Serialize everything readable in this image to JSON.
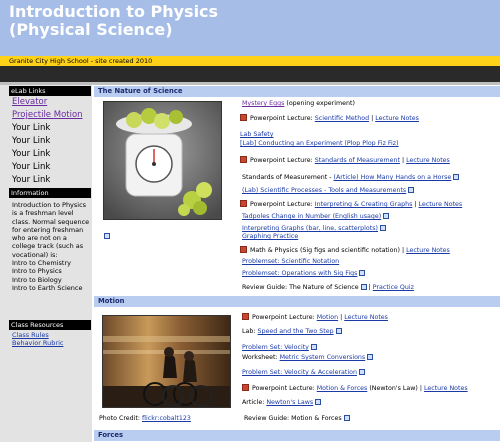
{
  "header": {
    "title_line1": "Introduction to Physics",
    "title_line2": "(Physical Science)",
    "subtitle": "Granite City High School - site created 2010"
  },
  "colors": {
    "header_bg": "#a6bde8",
    "yellow_bar": "#ffd21a",
    "section_head_bg": "#b8cdf0",
    "link": "#1a3aa8",
    "visited_link": "#6a2ca0"
  },
  "sidebar": {
    "elab_head": "eLab Links",
    "elab_links": [
      "Elevator",
      "Projectile Motion"
    ],
    "your_links": [
      "Your Link",
      "Your Link",
      "Your Link",
      "Your Link",
      "Your Link"
    ],
    "info_head": "Information",
    "info_text": "Introduction to Physics is a freshman level class. Normal sequence for entering freshman who are not on a college track (such as vocational) is:",
    "info_sequence": [
      "Intro to Chemistry",
      "Intro to Physics",
      "Intro to Biology",
      "Intro to Earth Science"
    ],
    "resources_head": "Class Resources",
    "resources": [
      "Class Rules",
      "Behavior Rubric"
    ]
  },
  "sections": {
    "science": {
      "title": "The Nature of Science",
      "mystery_eggs": "Mystery Eggs",
      "mystery_eggs_note": " (opening experiment)",
      "ppt1_prefix": "Powerpoint Lecture: ",
      "ppt1_link": "Scientific Method",
      "sep": " | ",
      "lecture_notes": "Lecture Notes",
      "lab_safety": "Lab Safety",
      "lab_experiment": "[Lab] Conducting an Experiment (Plop Plop Fiz Fiz)",
      "ppt2_link": "Standards of Measurement",
      "standards_prefix": "Standards of Measurement - ",
      "standards_link": "(Article) How Many Hands on a Horse",
      "lab_processes": "(Lab) Scientific Processes - Tools and Measurements",
      "ppt3_link": "Interpreting & Creating Graphs",
      "tadpoles": "Tadpoles Change in Number (English usage)",
      "interpreting_graphs": "Interpreting Graphs (bar, line, scatterplots)",
      "graphing_practice": "Graphing Practice",
      "math_physics": "Math & Physics (Sig figs and scientific notation)",
      "problemset1": "Problemset: Scientific Notation",
      "problemset2": "Problemset: Operations with Sig Figs",
      "review_prefix": "Review Guide: The Nature of Science",
      "practice_quiz": "Practice Quiz"
    },
    "motion": {
      "title": "Motion",
      "ppt_prefix": "Powerpoint Lecture: ",
      "ppt1_link": "Motion",
      "sep": " | ",
      "lecture_notes": "Lecture Notes",
      "lab_prefix": "Lab: ",
      "lab_link": "Speed and the Two Step",
      "problem_velocity": "Problem Set: Velocity",
      "worksheet_prefix": "Worksheet: ",
      "worksheet_link": "Metric System Conversions",
      "problem_vel_acc": "Problem Set: Velocity & Acceleration",
      "ppt2_link": "Motion & Forces",
      "ppt2_note": " (Newton's Law)",
      "article_prefix": "Article: ",
      "article_link": "Newton's Laws",
      "photo_credit_prefix": "Photo Credit: ",
      "photo_credit_link": "flickr:cobalt123",
      "review": "Review Guide: Motion & Forces"
    },
    "forces": {
      "title": "Forces"
    }
  }
}
